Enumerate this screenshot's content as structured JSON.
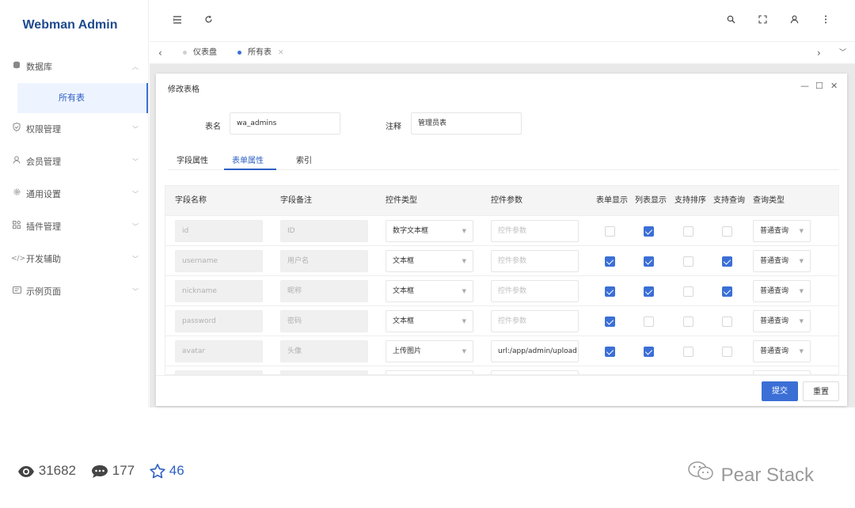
{
  "app": {
    "title": "Webman Admin"
  },
  "sidebar": {
    "items": [
      {
        "label": "数据库",
        "icon": "database-icon",
        "expanded": true
      },
      {
        "label": "所有表",
        "active": true
      },
      {
        "label": "权限管理",
        "icon": "shield-icon"
      },
      {
        "label": "会员管理",
        "icon": "user-icon"
      },
      {
        "label": "通用设置",
        "icon": "gear-icon"
      },
      {
        "label": "插件管理",
        "icon": "plugin-icon"
      },
      {
        "label": "开发辅助",
        "icon": "code-icon"
      },
      {
        "label": "示例页面",
        "icon": "page-icon"
      }
    ]
  },
  "header": {
    "icons": [
      "menu-fold-icon",
      "refresh-icon",
      "search-icon",
      "fullscreen-icon",
      "user-icon",
      "more-icon"
    ]
  },
  "tabs": [
    {
      "label": "仪表盘",
      "active": false
    },
    {
      "label": "所有表",
      "active": true
    }
  ],
  "dialog": {
    "title": "修改表格",
    "table_name_label": "表名",
    "table_name_value": "wa_admins",
    "comment_label": "注释",
    "comment_value": "管理员表",
    "subtabs": [
      "字段属性",
      "表单属性",
      "索引"
    ],
    "active_subtab": "表单属性",
    "columns": [
      "字段名称",
      "字段备注",
      "控件类型",
      "控件参数",
      "表单显示",
      "列表显示",
      "支持排序",
      "支持查询",
      "查询类型"
    ],
    "rows": [
      {
        "name": "id",
        "remark": "ID",
        "control": "数字文本框",
        "param": "",
        "param_placeholder": "控件参数",
        "form_show": false,
        "list_show": true,
        "sortable": false,
        "searchable": false,
        "query_type": "普通查询"
      },
      {
        "name": "username",
        "remark": "用户名",
        "control": "文本框",
        "param": "",
        "param_placeholder": "控件参数",
        "form_show": true,
        "list_show": true,
        "sortable": false,
        "searchable": true,
        "query_type": "普通查询"
      },
      {
        "name": "nickname",
        "remark": "昵称",
        "control": "文本框",
        "param": "",
        "param_placeholder": "控件参数",
        "form_show": true,
        "list_show": true,
        "sortable": false,
        "searchable": true,
        "query_type": "普通查询"
      },
      {
        "name": "password",
        "remark": "密码",
        "control": "文本框",
        "param": "",
        "param_placeholder": "控件参数",
        "form_show": true,
        "list_show": false,
        "sortable": false,
        "searchable": false,
        "query_type": "普通查询"
      },
      {
        "name": "avatar",
        "remark": "头像",
        "control": "上传图片",
        "param": "url:/app/admin/upload",
        "param_placeholder": "控件参数",
        "form_show": true,
        "list_show": true,
        "sortable": false,
        "searchable": false,
        "query_type": "普通查询"
      }
    ],
    "submit_label": "提交",
    "reset_label": "重置"
  },
  "stats": {
    "views": "31682",
    "comments": "177",
    "stars": "46"
  },
  "watermark": "Pear Stack",
  "colors": {
    "accent": "#3b6fd6",
    "logo": "#1e4a8e",
    "star": "#2d5fc3"
  }
}
